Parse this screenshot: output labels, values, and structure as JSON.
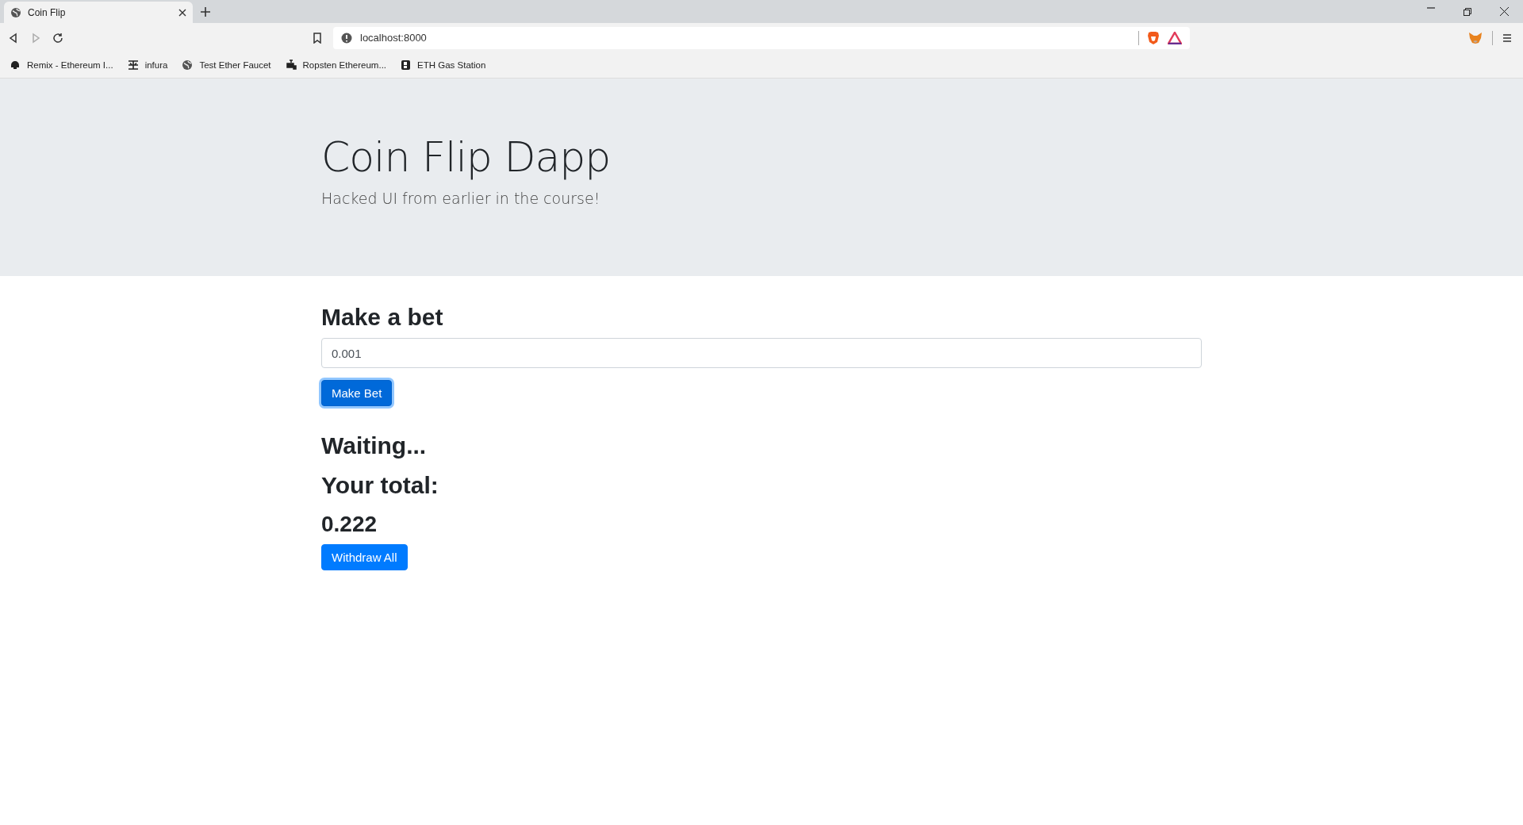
{
  "browser": {
    "tab": {
      "title": "Coin Flip"
    },
    "address": "localhost:8000",
    "bookmarks": [
      {
        "label": "Remix - Ethereum I..."
      },
      {
        "label": "infura"
      },
      {
        "label": "Test Ether Faucet"
      },
      {
        "label": "Ropsten Ethereum..."
      },
      {
        "label": "ETH Gas Station"
      }
    ]
  },
  "hero": {
    "title": "Coin Flip Dapp",
    "subtitle": "Hacked UI from earlier in the course!"
  },
  "bet": {
    "heading": "Make a bet",
    "amount": "0.001",
    "button": {
      "label": "Make Bet",
      "focused": true
    }
  },
  "status": "Waiting...",
  "total_label": "Your total:",
  "total": "0.222",
  "withdraw": {
    "label": "Withdraw All",
    "focused": false
  }
}
